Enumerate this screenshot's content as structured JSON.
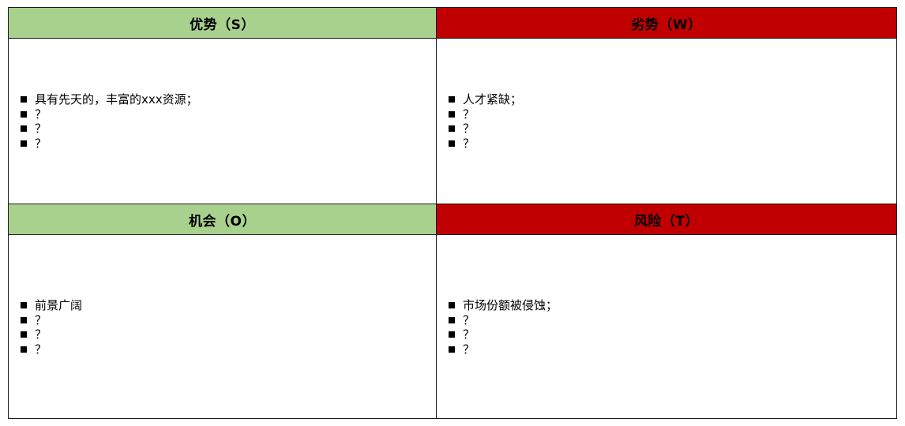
{
  "colors": {
    "green_header": "#a9d18e",
    "red_header": "#c00000",
    "border": "#1a1a1a"
  },
  "quadrants": {
    "strengths": {
      "title": "优势（S）",
      "items": [
        "具有先天的，丰富的xxx资源；",
        "？",
        "？",
        "？"
      ]
    },
    "weaknesses": {
      "title": "劣势（W）",
      "items": [
        "人才紧缺；",
        "？",
        "？",
        "？"
      ]
    },
    "opportunities": {
      "title": "机会（O）",
      "items": [
        "前景广阔",
        "？",
        "？",
        "？"
      ]
    },
    "threats": {
      "title": "风险（T）",
      "items": [
        "市场份额被侵蚀；",
        "？",
        "？",
        "？"
      ]
    }
  }
}
